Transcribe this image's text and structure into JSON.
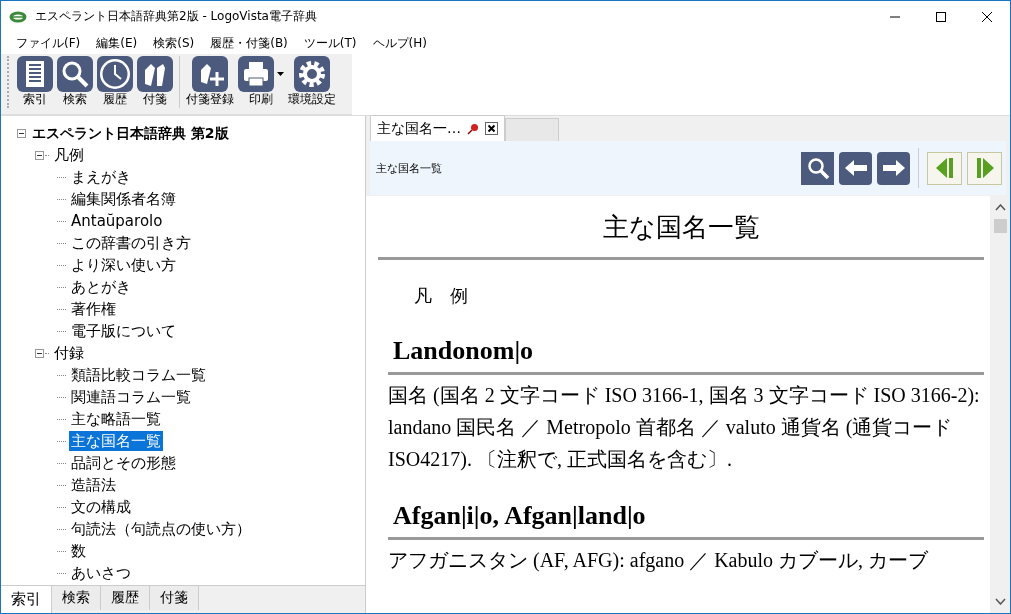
{
  "window": {
    "title": "エスペラント日本語辞典第2版 - LogoVista電子辞典"
  },
  "menu": [
    "ファイル(F)",
    "編集(E)",
    "検索(S)",
    "履歴・付箋(B)",
    "ツール(T)",
    "ヘルプ(H)"
  ],
  "toolbar": [
    [
      {
        "kind": "index",
        "label": "索引",
        "has_menu": false
      },
      {
        "kind": "search",
        "label": "検索",
        "has_menu": false
      },
      {
        "kind": "history",
        "label": "履歴",
        "has_menu": false
      },
      {
        "kind": "tag",
        "label": "付箋",
        "has_menu": false
      }
    ],
    [
      {
        "kind": "tag-add",
        "label": "付箋登録",
        "has_menu": false
      },
      {
        "kind": "print",
        "label": "印刷",
        "has_menu": true
      },
      {
        "kind": "settings",
        "label": "環境設定",
        "has_menu": false
      }
    ]
  ],
  "tree": {
    "label": "エスペラント日本語辞典 第2版",
    "expanded": true,
    "children": [
      {
        "label": "凡例",
        "expanded": true,
        "children": [
          {
            "label": "まえがき",
            "selected": false
          },
          {
            "label": "編集関係者名簿",
            "selected": false
          },
          {
            "label": "Antaŭparolo",
            "selected": false
          },
          {
            "label": "この辞書の引き方",
            "selected": false
          },
          {
            "label": "より深い使い方",
            "selected": false
          },
          {
            "label": "あとがき",
            "selected": false
          },
          {
            "label": "著作権",
            "selected": false
          },
          {
            "label": "電子版について",
            "selected": false
          }
        ]
      },
      {
        "label": "付録",
        "expanded": true,
        "children": [
          {
            "label": "類語比較コラム一覧",
            "selected": false
          },
          {
            "label": "関連語コラム一覧",
            "selected": false
          },
          {
            "label": "主な略語一覧",
            "selected": false
          },
          {
            "label": "主な国名一覧",
            "selected": true
          },
          {
            "label": "品詞とその形態",
            "selected": false
          },
          {
            "label": "造語法",
            "selected": false
          },
          {
            "label": "文の構成",
            "selected": false
          },
          {
            "label": "句読法（句読点の使い方）",
            "selected": false
          },
          {
            "label": "数",
            "selected": false
          },
          {
            "label": "あいさつ",
            "selected": false
          }
        ]
      }
    ]
  },
  "left_tabs": [
    {
      "label": "索引",
      "selected": true
    },
    {
      "label": "検索",
      "selected": false
    },
    {
      "label": "履歴",
      "selected": false
    },
    {
      "label": "付箋",
      "selected": false
    }
  ],
  "doc_tabs": [
    {
      "label": "主な国名一…",
      "selected": true
    }
  ],
  "header": {
    "title": "主な国名一覧"
  },
  "content": {
    "title": "主な国名一覧",
    "legend": "凡　例",
    "entries": [
      {
        "headword": "Landonom|o",
        "body": "国名 (国名 2 文字コード ISO 3166-1, 国名 3 文字コード ISO 3166-2): landano 国民名 ／ Metropolo 首都名 ／ valuto 通貨名 (通貨コード ISO4217). 〔注釈で, 正式国名を含む〕."
      },
      {
        "headword": "Afgan|i|o, Afgan|land|o",
        "body": "アフガニスタン (AF, AFG): afgano ／ Kabulo カブール, カーブ"
      }
    ]
  }
}
